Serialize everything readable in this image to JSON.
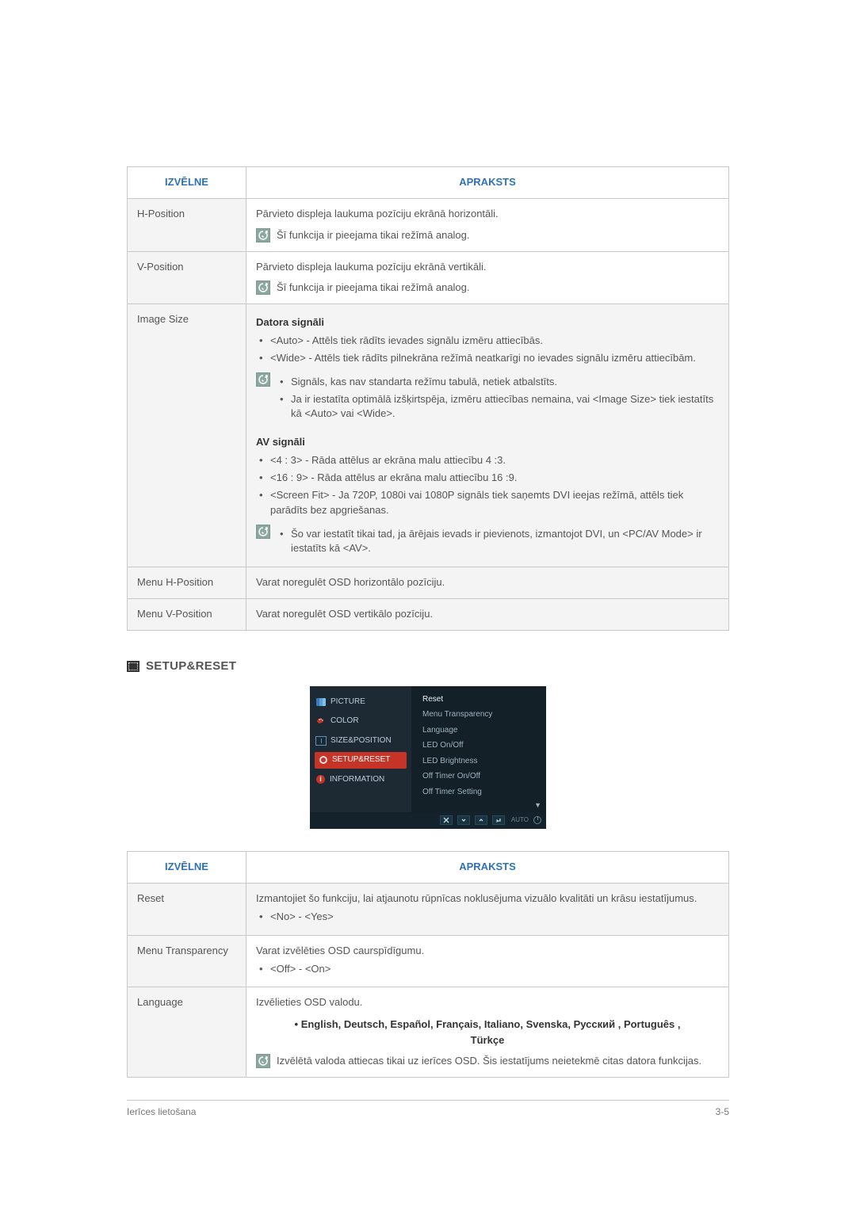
{
  "table1": {
    "headers": {
      "menu": "IZVĒLNE",
      "desc": "APRAKSTS"
    },
    "rows": {
      "hpos": {
        "label": "H-Position",
        "text": "Pārvieto displeja laukuma pozīciju ekrānā horizontāli.",
        "note": "Šī funkcija ir pieejama tikai režīmā analog."
      },
      "vpos": {
        "label": "V-Position",
        "text": "Pārvieto displeja laukuma pozīciju ekrānā vertikāli.",
        "note": "Šī funkcija ir pieejama tikai režīmā analog."
      },
      "imagesize": {
        "label": "Image Size",
        "pc_head": "Datora signāli",
        "pc_b1": "<Auto> - Attēls tiek rādīts ievades signālu izmēru attiecībās.",
        "pc_b2": "<Wide> - Attēls tiek rādīts pilnekrāna režīmā neatkarīgi no ievades signālu izmēru attiecībām.",
        "pc_note_b1": "Signāls, kas nav standarta režīmu tabulā, netiek atbalstīts.",
        "pc_note_b2": "Ja ir iestatīta optimālā izšķirtspēja, izmēru attiecības nemaina, vai <Image Size> tiek iestatīts kā <Auto> vai <Wide>.",
        "av_head": "AV signāli",
        "av_b1": "<4 : 3> - Rāda attēlus ar ekrāna malu attiecību 4 :3.",
        "av_b2": "<16 : 9> - Rāda attēlus ar ekrāna malu attiecību 16 :9.",
        "av_b3": "<Screen Fit> - Ja 720P, 1080i vai 1080P signāls tiek saņemts DVI ieejas režīmā, attēls tiek parādīts bez apgriešanas.",
        "av_note": "Šo var iestatīt tikai tad, ja ārējais ievads ir pievienots, izmantojot DVI, un <PC/AV Mode> ir iestatīts kā <AV>."
      },
      "menuh": {
        "label": "Menu H-Position",
        "text": "Varat noregulēt OSD horizontālo pozīciju."
      },
      "menuv": {
        "label": "Menu V-Position",
        "text": "Varat noregulēt OSD vertikālo pozīciju."
      }
    }
  },
  "section": {
    "title": "SETUP&RESET"
  },
  "osd": {
    "left": {
      "picture": "PICTURE",
      "color": "COLOR",
      "size": "SIZE&POSITION",
      "setup": "SETUP&RESET",
      "info": "INFORMATION"
    },
    "right": {
      "reset": "Reset",
      "menu_trans": "Menu Transparency",
      "language": "Language",
      "led_on": "LED On/Off",
      "led_bright": "LED Brightness",
      "off_timer_on": "Off Timer On/Off",
      "off_timer_set": "Off Timer Setting"
    },
    "footer_auto": "AUTO"
  },
  "table2": {
    "headers": {
      "menu": "IZVĒLNE",
      "desc": "APRAKSTS"
    },
    "rows": {
      "reset": {
        "label": "Reset",
        "text": "Izmantojiet šo funkciju, lai atjaunotu rūpnīcas noklusējuma vizuālo kvalitāti un krāsu iestatījumus.",
        "b1": "<No> - <Yes>"
      },
      "menu_trans": {
        "label": "Menu Transparency",
        "text": "Varat izvēlēties OSD caurspīdīgumu.",
        "b1": "<Off> - <On>"
      },
      "language": {
        "label": "Language",
        "text": "Izvēlieties OSD valodu.",
        "langs": "• English, Deutsch, Español, Français,  Italiano, Svenska, Русский , Português , Türkçe",
        "note": "Izvēlētā valoda attiecas tikai uz ierīces OSD. Šis iestatījums neietekmē citas datora funkcijas."
      }
    }
  },
  "footer": {
    "left": "Ierīces lietošana",
    "right": "3-5"
  }
}
